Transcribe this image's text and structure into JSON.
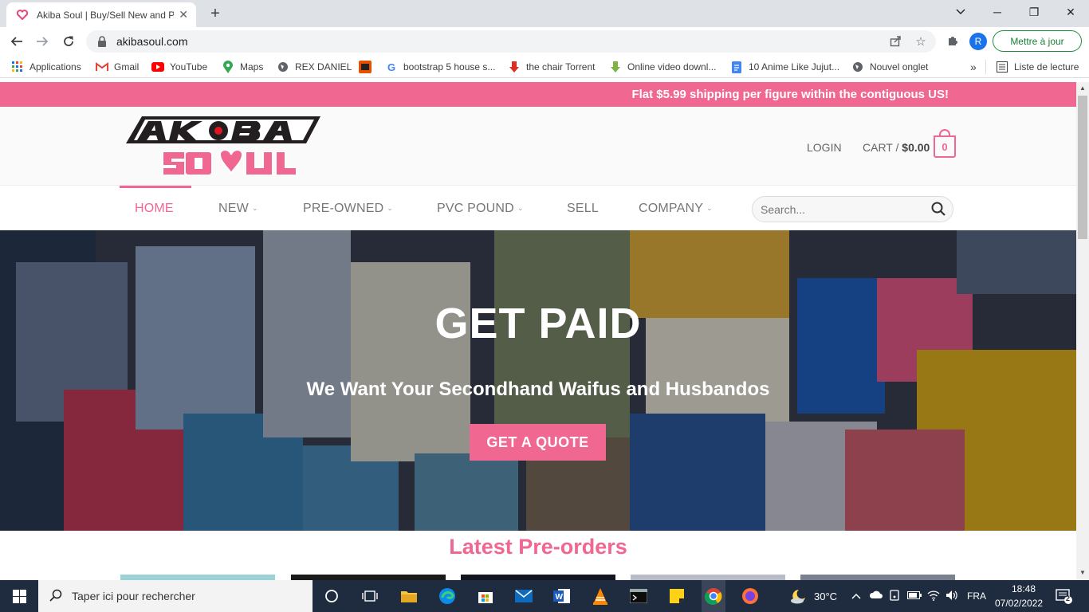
{
  "browser": {
    "tab": {
      "title": "Akiba Soul | Buy/Sell New and Pre",
      "close": "✕"
    },
    "new_tab": "+",
    "window_controls": {
      "minimize": "─",
      "restore": "❐",
      "close": "✕"
    },
    "omnibox": {
      "url": "akibasoul.com"
    },
    "profile_initial": "R",
    "update_button": "Mettre à jour",
    "bookmarks": [
      {
        "label": "Applications",
        "icon": "apps-grid-icon"
      },
      {
        "label": "Gmail",
        "icon": "gmail-icon"
      },
      {
        "label": "YouTube",
        "icon": "youtube-icon"
      },
      {
        "label": "Maps",
        "icon": "maps-icon"
      },
      {
        "label": "REX DANIEL",
        "icon": "globe-icon"
      },
      {
        "label": "",
        "icon": "site-icon"
      },
      {
        "label": "bootstrap 5 house s...",
        "icon": "google-icon"
      },
      {
        "label": "the chair Torrent",
        "icon": "torrent-icon"
      },
      {
        "label": "Online video downl...",
        "icon": "download-icon"
      },
      {
        "label": "10 Anime Like Jujut...",
        "icon": "doc-icon"
      },
      {
        "label": "Nouvel onglet",
        "icon": "globe-icon"
      }
    ],
    "bookmarks_overflow": "»",
    "reading_list": "Liste de lecture"
  },
  "site": {
    "promo": "Flat $5.99 shipping per figure within the contiguous US!",
    "logo_alt": "AKIBA SOUL",
    "header": {
      "login": "LOGIN",
      "cart_label": "CART / ",
      "cart_total": "$0.00",
      "cart_count": "0"
    },
    "nav": [
      {
        "label": "HOME",
        "dropdown": false,
        "active": true
      },
      {
        "label": "NEW",
        "dropdown": true,
        "active": false
      },
      {
        "label": "PRE-OWNED",
        "dropdown": true,
        "active": false
      },
      {
        "label": "PVC POUND",
        "dropdown": true,
        "active": false
      },
      {
        "label": "SELL",
        "dropdown": false,
        "active": false
      },
      {
        "label": "COMPANY",
        "dropdown": true,
        "active": false
      }
    ],
    "search_placeholder": "Search...",
    "hero": {
      "title": "GET PAID",
      "subtitle": "We Want Your Secondhand Waifus and Husbandos",
      "button": "GET A QUOTE"
    },
    "latest_title": "Latest Pre-orders"
  },
  "taskbar": {
    "search_placeholder": "Taper ici pour rechercher",
    "weather": "30°C",
    "language": "FRA",
    "time": "18:48",
    "date": "07/02/2022",
    "notification_count": "2"
  },
  "colors": {
    "brand_pink": "#f06791",
    "taskbar": "#1f2b3e"
  }
}
